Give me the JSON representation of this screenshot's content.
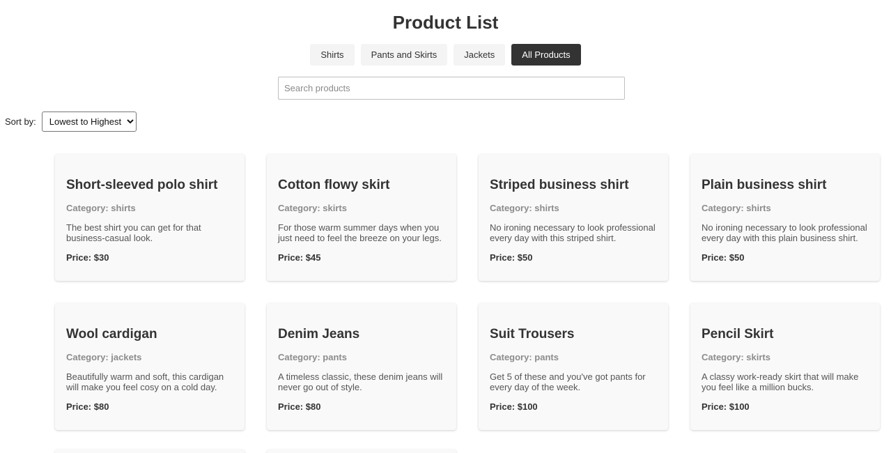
{
  "page": {
    "title": "Product List"
  },
  "filters": [
    {
      "label": "Shirts",
      "active": false
    },
    {
      "label": "Pants and Skirts",
      "active": false
    },
    {
      "label": "Jackets",
      "active": false
    },
    {
      "label": "All Products",
      "active": true
    }
  ],
  "search": {
    "placeholder": "Search products",
    "value": ""
  },
  "sort": {
    "label": "Sort by:",
    "selected": "Lowest to Highest"
  },
  "products": [
    {
      "title": "Short-sleeved polo shirt",
      "category": "Category: shirts",
      "description": "The best shirt you can get for that business-casual look.",
      "price": "Price: $30"
    },
    {
      "title": "Cotton flowy skirt",
      "category": "Category: skirts",
      "description": "For those warm summer days when you just need to feel the breeze on your legs.",
      "price": "Price: $45"
    },
    {
      "title": "Striped business shirt",
      "category": "Category: shirts",
      "description": "No ironing necessary to look professional every day with this striped shirt.",
      "price": "Price: $50"
    },
    {
      "title": "Plain business shirt",
      "category": "Category: shirts",
      "description": "No ironing necessary to look professional every day with this plain business shirt.",
      "price": "Price: $50"
    },
    {
      "title": "Wool cardigan",
      "category": "Category: jackets",
      "description": "Beautifully warm and soft, this cardigan will make you feel cosy on a cold day.",
      "price": "Price: $80"
    },
    {
      "title": "Denim Jeans",
      "category": "Category: pants",
      "description": "A timeless classic, these denim jeans will never go out of style.",
      "price": "Price: $80"
    },
    {
      "title": "Suit Trousers",
      "category": "Category: pants",
      "description": "Get 5 of these and you've got pants for every day of the week.",
      "price": "Price: $100"
    },
    {
      "title": "Pencil Skirt",
      "category": "Category: skirts",
      "description": "A classy work-ready skirt that will make you feel like a million bucks.",
      "price": "Price: $100"
    }
  ],
  "colors": {
    "active_filter_bg": "#333333",
    "filter_bg": "#f4f4f4",
    "card_bg": "#f9f9f9",
    "category_text": "#8c8c8c"
  }
}
